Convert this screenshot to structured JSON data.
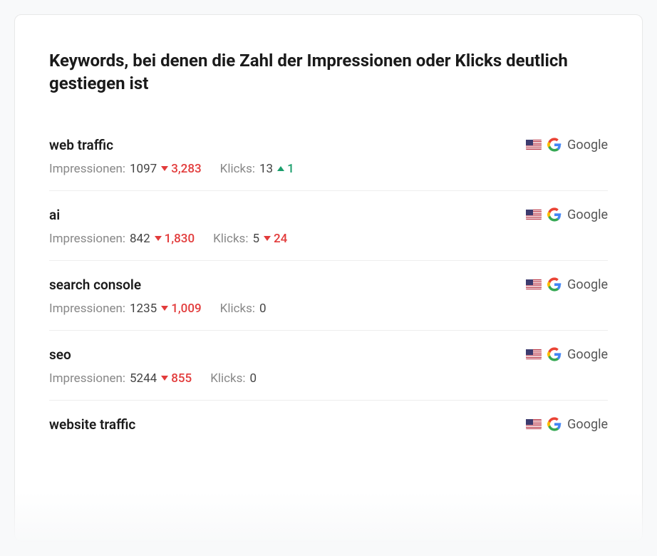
{
  "title": "Keywords, bei denen die Zahl der Impressionen oder Klicks deutlich gestiegen ist",
  "labels": {
    "impressions": "Impressionen:",
    "clicks": "Klicks:"
  },
  "engine": {
    "name": "Google",
    "country": "US"
  },
  "keywords": [
    {
      "name": "web traffic",
      "impressions": "1097",
      "impressions_delta": "3,283",
      "impressions_dir": "down",
      "clicks": "13",
      "clicks_delta": "1",
      "clicks_dir": "up"
    },
    {
      "name": "ai",
      "impressions": "842",
      "impressions_delta": "1,830",
      "impressions_dir": "down",
      "clicks": "5",
      "clicks_delta": "24",
      "clicks_dir": "down"
    },
    {
      "name": "search console",
      "impressions": "1235",
      "impressions_delta": "1,009",
      "impressions_dir": "down",
      "clicks": "0",
      "clicks_delta": "",
      "clicks_dir": ""
    },
    {
      "name": "seo",
      "impressions": "5244",
      "impressions_delta": "855",
      "impressions_dir": "down",
      "clicks": "0",
      "clicks_delta": "",
      "clicks_dir": ""
    },
    {
      "name": "website traffic",
      "impressions": "",
      "impressions_delta": "",
      "impressions_dir": "",
      "clicks": "",
      "clicks_delta": "",
      "clicks_dir": ""
    }
  ]
}
